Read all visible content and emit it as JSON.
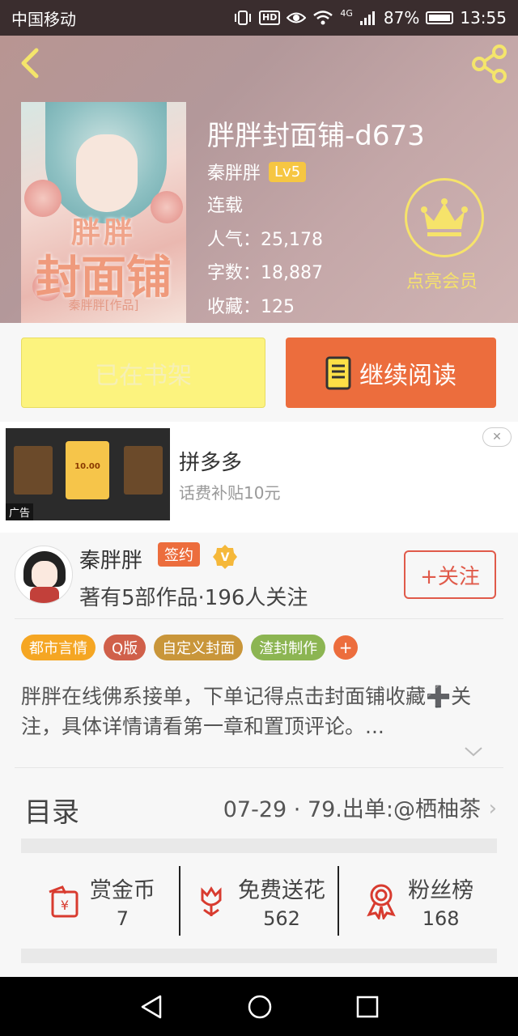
{
  "status_bar": {
    "carrier": "中国移动",
    "hd": "HD",
    "network": "4G",
    "battery": "87%",
    "time": "13:55"
  },
  "book": {
    "title": "胖胖封面铺-d673",
    "author": "秦胖胖",
    "level": "Lv5",
    "status": "连载",
    "popularity": "人气：25,178",
    "words": "字数：18,887",
    "favorites": "收藏：125",
    "vip_label": "点亮会员",
    "cover": {
      "title_top": "胖胖",
      "title_main": "封面铺",
      "author_line": "秦胖胖[作品]"
    }
  },
  "actions": {
    "shelf_label": "已在书架",
    "read_label": "继续阅读"
  },
  "ad": {
    "title": "拼多多",
    "desc": "话费补贴10元",
    "tag": "广告",
    "thumb_amount": "10.00"
  },
  "author_card": {
    "name": "秦胖胖",
    "sign_badge": "签约",
    "stats": "著有5部作品·196人关注",
    "follow_label": "+关注"
  },
  "tags": [
    {
      "label": "都市言情",
      "color": "#f5a623"
    },
    {
      "label": "Q版",
      "color": "#d0604a"
    },
    {
      "label": "自定义封面",
      "color": "#c9963a"
    },
    {
      "label": "渣封制作",
      "color": "#8cb552"
    }
  ],
  "tag_add": "+",
  "description": "胖胖在线佛系接单，下单记得点击封面铺收藏➕关注，具体详情请看第一章和置顶评论。...",
  "toc": {
    "label": "目录",
    "latest": "07-29 · 79.出单:@栖柚茶",
    "chevron": "›"
  },
  "stats": [
    {
      "label": "赏金币",
      "value": "7",
      "icon": "red-envelope-icon"
    },
    {
      "label": "免费送花",
      "value": "562",
      "icon": "flower-icon"
    },
    {
      "label": "粉丝榜",
      "value": "168",
      "icon": "medal-icon"
    }
  ],
  "colors": {
    "accent": "#ec6d3d",
    "shelf_button": "#fcf37e",
    "vip": "#f6e36a",
    "icon_red": "#d83b2f"
  }
}
